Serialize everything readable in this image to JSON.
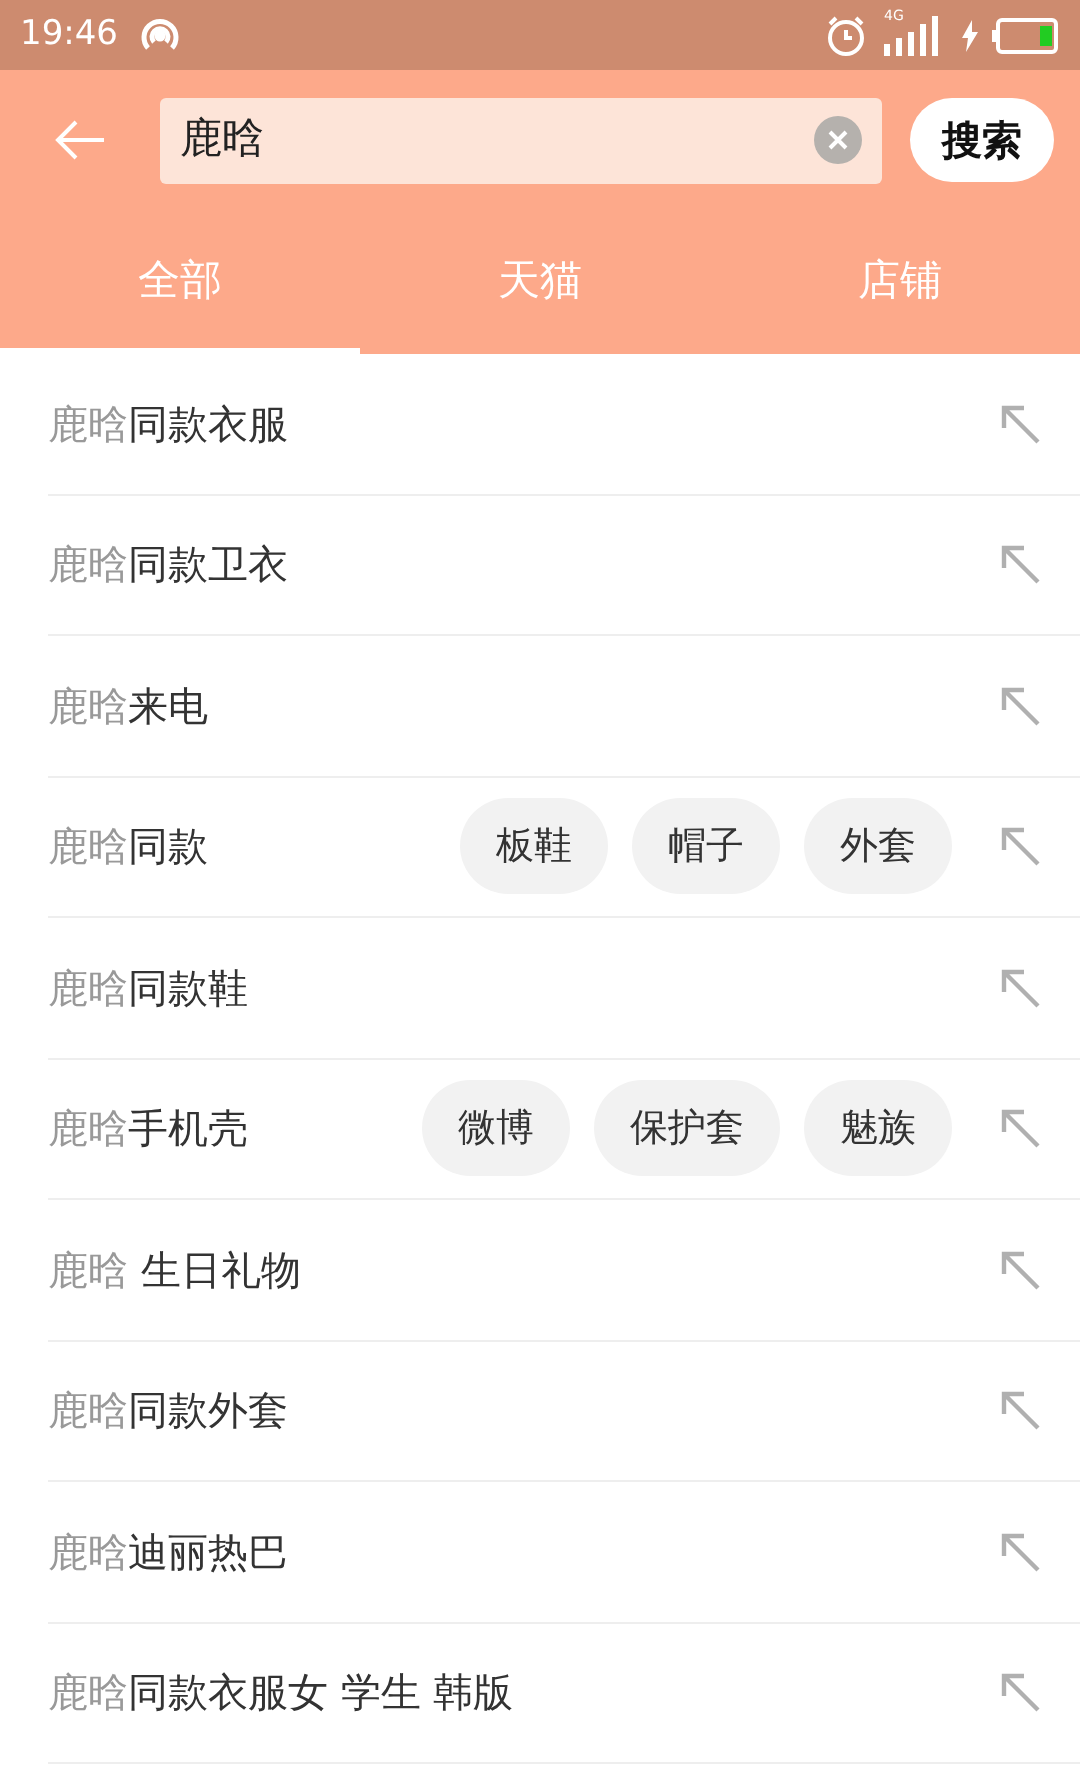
{
  "status_bar": {
    "time": "19:46",
    "network": "4G"
  },
  "search": {
    "value": "鹿晗",
    "button": "搜索"
  },
  "tabs": [
    {
      "label": "全部",
      "selected": true
    },
    {
      "label": "天猫",
      "selected": false
    },
    {
      "label": "店铺",
      "selected": false
    }
  ],
  "suggestions": [
    {
      "match": "鹿晗",
      "rest": "同款衣服"
    },
    {
      "match": "鹿晗",
      "rest": "同款卫衣"
    },
    {
      "match": "鹿晗",
      "rest": "来电"
    },
    {
      "match": "鹿晗",
      "rest": "同款",
      "tags": [
        "板鞋",
        "帽子",
        "外套"
      ]
    },
    {
      "match": "鹿晗",
      "rest": "同款鞋"
    },
    {
      "match": "鹿晗",
      "rest": "手机壳",
      "tags": [
        "微博",
        "保护套",
        "魅族"
      ]
    },
    {
      "match": "鹿晗",
      "rest": " 生日礼物"
    },
    {
      "match": "鹿晗",
      "rest": "同款外套"
    },
    {
      "match": "鹿晗",
      "rest": "迪丽热巴"
    },
    {
      "match": "鹿晗",
      "rest": "同款衣服女 学生 韩版"
    }
  ]
}
